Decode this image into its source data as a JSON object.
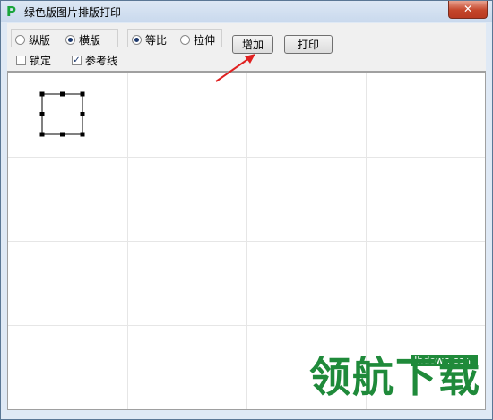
{
  "window": {
    "title": "绿色版图片排版打印",
    "icon": "P",
    "close_label": "✕"
  },
  "toolbar": {
    "orientation": {
      "portrait": "纵版",
      "landscape": "横版",
      "selected": "landscape"
    },
    "scale": {
      "proportional": "等比",
      "stretch": "拉伸",
      "selected": "proportional"
    },
    "lock": {
      "label": "锁定",
      "checked": false
    },
    "guides": {
      "label": "参考线",
      "checked": true
    },
    "add_label": "增加",
    "print_label": "打印"
  },
  "watermark": {
    "text": "领航下载",
    "url": "lhdown.com"
  },
  "colors": {
    "grid": "#e6e6e6",
    "arrow": "#e02020",
    "titlebar": "#dce7f4"
  }
}
